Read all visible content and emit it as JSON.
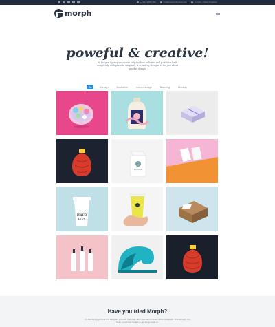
{
  "topbar": {
    "social_icons": [
      "facebook-icon",
      "twitter-icon",
      "google-plus-icon",
      "linkedin-icon",
      "rss-icon"
    ],
    "contacts": [
      {
        "icon": "phone-icon",
        "text": "+44 123 456 789"
      },
      {
        "icon": "email-icon",
        "text": "mail@morph-themes.com"
      },
      {
        "icon": "location-icon",
        "text": "London, United Kingdom"
      }
    ]
  },
  "header": {
    "logo_text": "morph",
    "menu_icon": "hamburger-menu-icon"
  },
  "hero": {
    "headline": "poweful & creative!",
    "intro": "At League Agency we obsess only the best websites and portfolios built completely with passion, simplicity & creativity! League is not just about graphic design."
  },
  "filters": [
    {
      "label": "All",
      "active": true
    },
    {
      "label": "Design",
      "active": false
    },
    {
      "label": "Illustration",
      "active": false
    },
    {
      "label": "Interior design",
      "active": false
    },
    {
      "label": "Branding",
      "active": false
    },
    {
      "label": "Mockup",
      "active": false
    }
  ],
  "portfolio": [
    {
      "title": "Candy bowl",
      "bg": "#e8478b"
    },
    {
      "title": "Glass bottle",
      "bg": "#a9dfe0"
    },
    {
      "title": "Gift box",
      "bg": "#ececec"
    },
    {
      "title": "Red paper bag",
      "bg": "#1c2230"
    },
    {
      "title": "Milk carton",
      "bg": "#f4f4f4"
    },
    {
      "title": "Business cards",
      "bg": "#f19335"
    },
    {
      "title": "Coffee cup",
      "bg": "#bfe0e6"
    },
    {
      "title": "Yellow cup",
      "bg": "#f5f5f5"
    },
    {
      "title": "Kraft box",
      "bg": "#cfe5ee"
    },
    {
      "title": "Bottles",
      "bg": "#f4c2c9"
    },
    {
      "title": "Wave",
      "bg": "#f0f0f0"
    },
    {
      "title": "Red bag",
      "bg": "#1a1f2c"
    }
  ],
  "cta": {
    "title": "Have you tried Morph?",
    "text": "It's like saying you're a fine designer, you love fresh fast, don't just listen in every other paragraph. Free enough, but fresh, not all and it takes to get things back on."
  },
  "colors": {
    "accent": "#2e8cdb",
    "dark": "#2a3442",
    "topbar": "#1f2b3a"
  }
}
